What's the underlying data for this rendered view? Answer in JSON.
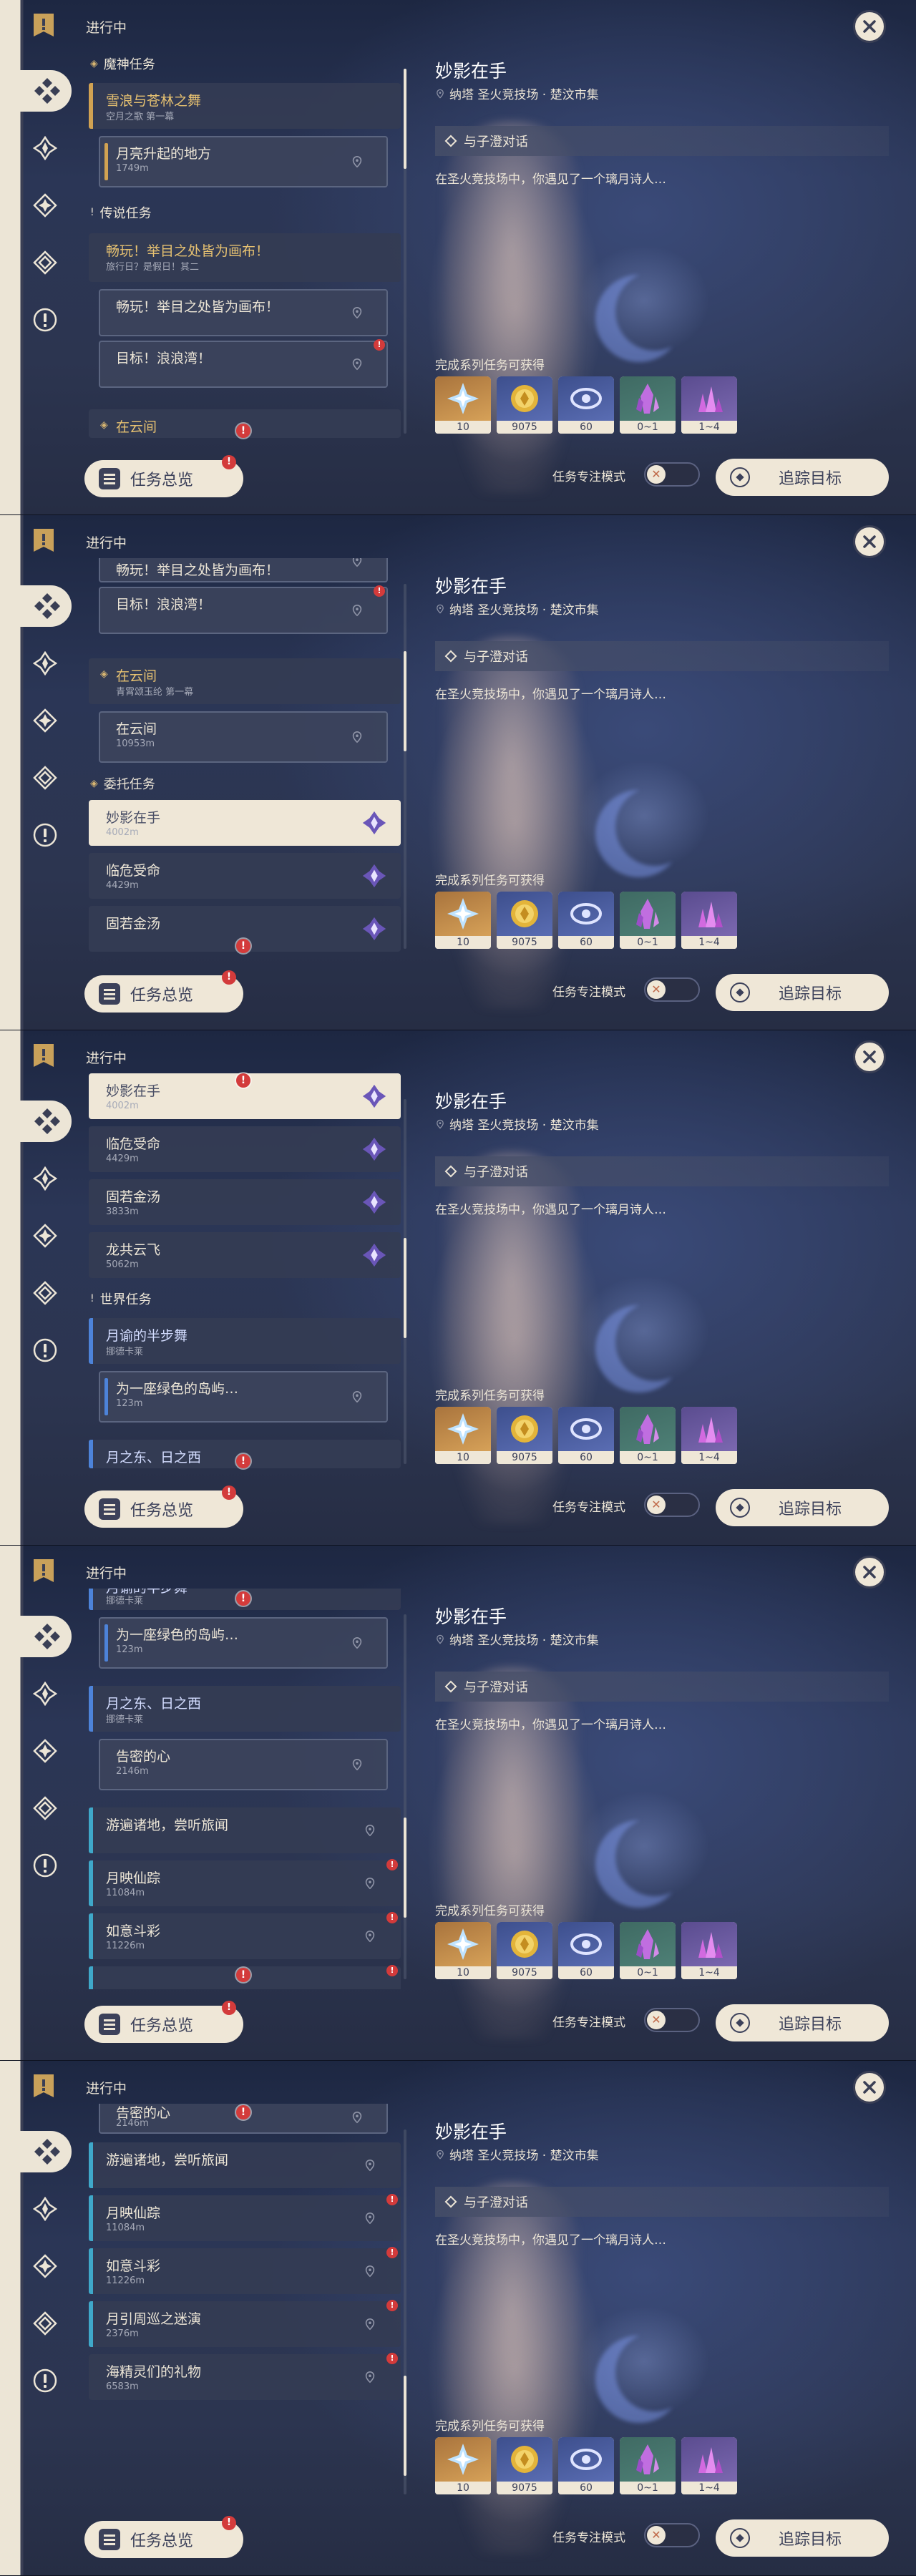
{
  "header": {
    "in_progress": "进行中"
  },
  "footer": {
    "overview_label": "任务总览",
    "focus_mode_label": "任务专注模式",
    "track_label": "追踪目标",
    "toggle_knob": "✕"
  },
  "alert_glyph": "!",
  "detail": {
    "title": "妙影在手",
    "location": "纳塔 圣火竞技场 · 楚汶市集",
    "objective": "与子澄对话",
    "description": "在圣火竞技场中，你遇见了一个璃月诗人…",
    "rewards_heading": "完成系列任务可获得",
    "rewards": [
      {
        "icon": "adventure-exp-icon",
        "count": "10",
        "bg": "orange"
      },
      {
        "icon": "mora-icon",
        "count": "9075",
        "bg": "blue"
      },
      {
        "icon": "fate-exp-icon",
        "count": "60",
        "bg": "blue"
      },
      {
        "icon": "crystal-icon",
        "count": "0~1",
        "bg": "green"
      },
      {
        "icon": "crystal-chunk-icon",
        "count": "1~4",
        "bg": "purple"
      }
    ]
  },
  "sections": {
    "archon": "魔神任务",
    "legend": "传说任务",
    "commission": "委托任务",
    "world": "世界任务"
  },
  "quests": {
    "snow": {
      "title": "雪浪与苍林之舞",
      "sub": "空月之歌 第一幕"
    },
    "moon_rise": {
      "title": "月亮升起的地方",
      "dist": "1749m"
    },
    "joy_main": {
      "title": "畅玩！举目之处皆为画布！",
      "sub": "旅行日？是假日！其二"
    },
    "joy_sub1": {
      "title": "畅玩！举目之处皆为画布！"
    },
    "joy_sub2": {
      "title": "目标！浪浪湾！"
    },
    "cloud_main": {
      "title": "在云间",
      "sub": "青霄颂玉纶 第一幕"
    },
    "cloud_sub": {
      "title": "在云间",
      "dist": "10953m"
    },
    "miaoying": {
      "title": "妙影在手",
      "dist": "4002m"
    },
    "linwei": {
      "title": "临危受命",
      "dist": "4429m"
    },
    "gujin": {
      "title": "固若金汤",
      "dist": "3833m"
    },
    "longgong": {
      "title": "龙共云飞",
      "dist": "5062m"
    },
    "moon_dance": {
      "title": "月谕的半步舞",
      "sub": "挪德卡莱"
    },
    "green_island": {
      "title": "为一座绿色的岛屿…",
      "dist": "123m"
    },
    "moon_east": {
      "title": "月之东、日之西",
      "sub": "挪德卡莱"
    },
    "secret_heart": {
      "title": "告密的心",
      "dist": "2146m"
    },
    "wander": {
      "title": "游遍诸地，尝听旅闻"
    },
    "moon_shadow": {
      "title": "月映仙踪",
      "dist": "11084m"
    },
    "ruyi": {
      "title": "如意斗彩",
      "dist": "11226m"
    },
    "moon_path": {
      "title": "月引周巡之迷演",
      "dist": "2376m"
    },
    "sea_gift": {
      "title": "海精灵们的礼物",
      "dist": "6583m"
    }
  }
}
